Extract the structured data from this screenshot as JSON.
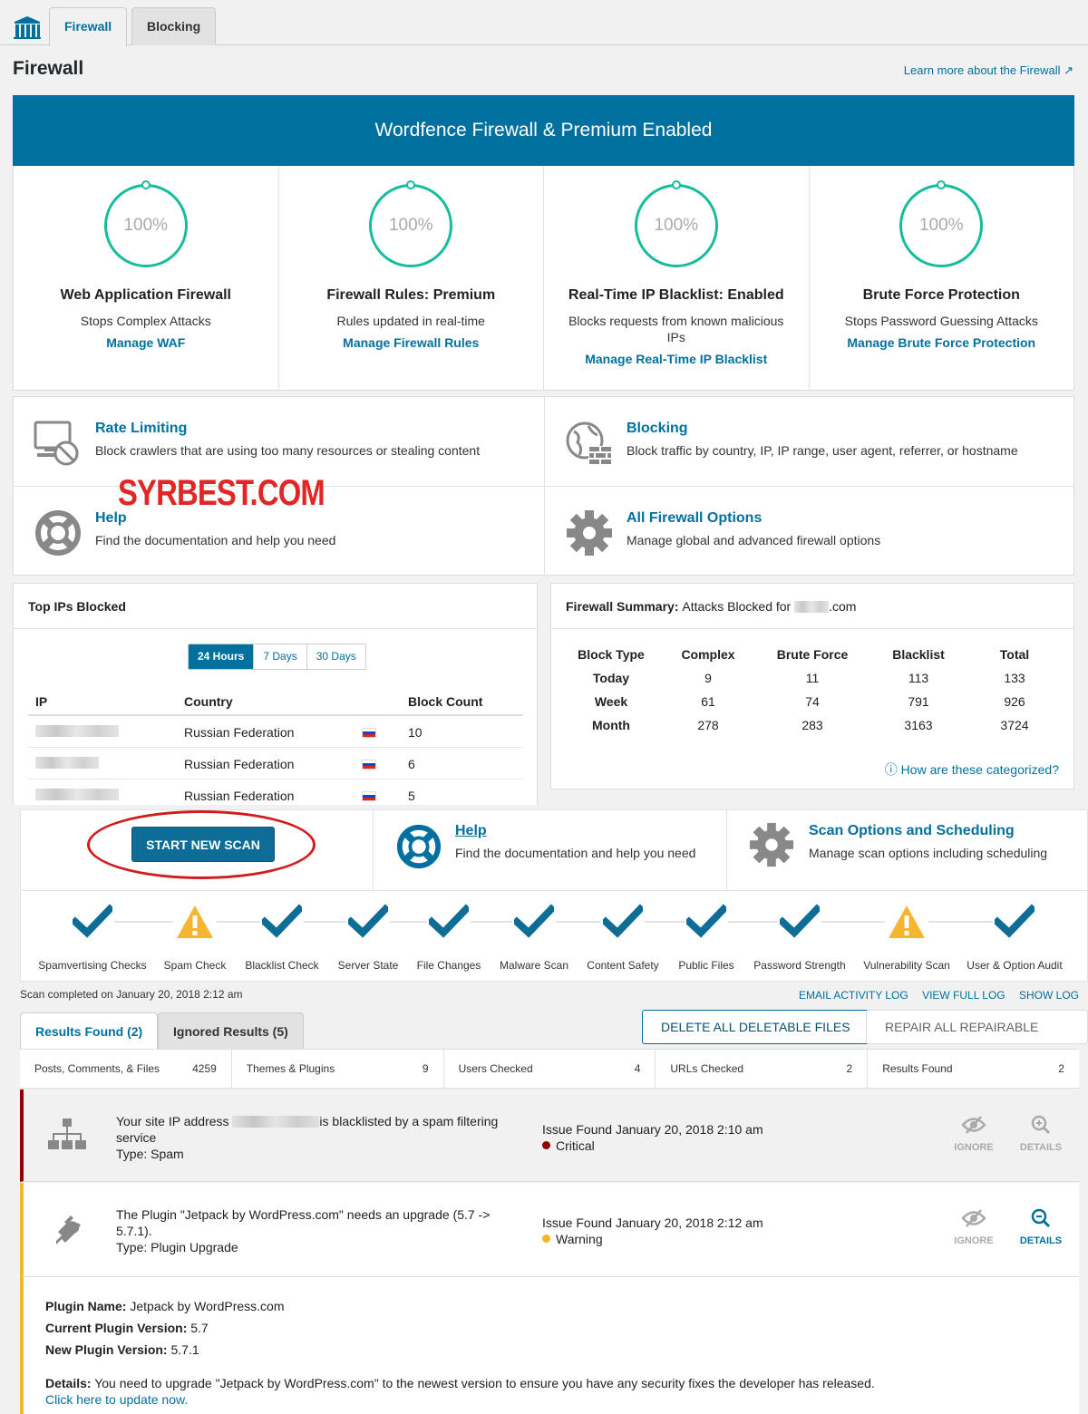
{
  "tabs": [
    {
      "label": "Firewall"
    },
    {
      "label": "Blocking"
    }
  ],
  "page": {
    "title": "Firewall",
    "learn_more": "Learn more about the Firewall"
  },
  "banner": {
    "title": "Wordfence Firewall & Premium Enabled"
  },
  "features": [
    {
      "percent": "100%",
      "value": 100,
      "title": "Web Application Firewall",
      "desc": "Stops Complex Attacks",
      "link": "Manage WAF"
    },
    {
      "percent": "100%",
      "value": 100,
      "title": "Firewall Rules: Premium",
      "desc": "Rules updated in real-time",
      "link": "Manage Firewall Rules"
    },
    {
      "percent": "100%",
      "value": 100,
      "title": "Real-Time IP Blacklist: Enabled",
      "desc": "Blocks requests from known malicious IPs",
      "link": "Manage Real-Time IP Blacklist"
    },
    {
      "percent": "100%",
      "value": 100,
      "title": "Brute Force Protection",
      "desc": "Stops Password Guessing Attacks",
      "link": "Manage Brute Force Protection"
    }
  ],
  "options": {
    "rate_limiting": {
      "title": "Rate Limiting",
      "desc": "Block crawlers that are using too many resources or stealing content"
    },
    "blocking": {
      "title": "Blocking",
      "desc": "Block traffic by country, IP, IP range, user agent, referrer, or hostname"
    },
    "help": {
      "title": "Help",
      "desc": "Find the documentation and help you need"
    },
    "all_options": {
      "title": "All Firewall Options",
      "desc": "Manage global and advanced firewall options"
    }
  },
  "watermark": "SYRBEST.COM",
  "top_ips": {
    "title": "Top IPs Blocked",
    "ranges": [
      "24 Hours",
      "7 Days",
      "30 Days"
    ],
    "selected_range": "24 Hours",
    "columns": [
      "IP",
      "Country",
      "Block Count"
    ],
    "rows": [
      {
        "country": "Russian Federation",
        "count": "10"
      },
      {
        "country": "Russian Federation",
        "count": "6"
      },
      {
        "country": "Russian Federation",
        "count": "5"
      }
    ]
  },
  "summary": {
    "title": "Firewall Summary:",
    "subtitle_prefix": "Attacks Blocked for",
    "subtitle_suffix": ".com",
    "columns": [
      "Block Type",
      "Complex",
      "Brute Force",
      "Blacklist",
      "Total"
    ],
    "rows": [
      [
        "Today",
        "9",
        "11",
        "113",
        "133"
      ],
      [
        "Week",
        "61",
        "74",
        "791",
        "926"
      ],
      [
        "Month",
        "278",
        "283",
        "3163",
        "3724"
      ]
    ],
    "categorized_link": "How are these categorized?"
  },
  "scan": {
    "start_button": "START NEW SCAN",
    "help": {
      "title": "Help",
      "desc": "Find the documentation and help you need"
    },
    "options": {
      "title": "Scan Options and Scheduling",
      "desc": "Manage scan options including scheduling"
    },
    "steps": [
      {
        "label": "Spamvertising Checks",
        "status": "ok"
      },
      {
        "label": "Spam Check",
        "status": "warning"
      },
      {
        "label": "Blacklist Check",
        "status": "ok"
      },
      {
        "label": "Server State",
        "status": "ok"
      },
      {
        "label": "File Changes",
        "status": "ok"
      },
      {
        "label": "Malware Scan",
        "status": "ok"
      },
      {
        "label": "Content Safety",
        "status": "ok"
      },
      {
        "label": "Public Files",
        "status": "ok"
      },
      {
        "label": "Password Strength",
        "status": "ok"
      },
      {
        "label": "Vulnerability Scan",
        "status": "warning"
      },
      {
        "label": "User & Option Audit",
        "status": "ok"
      }
    ],
    "completed": "Scan completed on January 20, 2018 2:12 am",
    "log_links": [
      "EMAIL ACTIVITY LOG",
      "VIEW FULL LOG",
      "SHOW LOG"
    ],
    "results_tab": "Results Found (2)",
    "ignored_tab": "Ignored Results (5)",
    "delete_button": "DELETE ALL DELETABLE FILES",
    "repair_button": "REPAIR ALL REPAIRABLE FILES",
    "stats": [
      {
        "label": "Posts, Comments, & Files",
        "value": "4259"
      },
      {
        "label": "Themes & Plugins",
        "value": "9"
      },
      {
        "label": "Users Checked",
        "value": "4"
      },
      {
        "label": "URLs Checked",
        "value": "2"
      },
      {
        "label": "Results Found",
        "value": "2"
      }
    ]
  },
  "issues": [
    {
      "text_a": "Your site IP address",
      "text_b": "is blacklisted by a spam filtering service",
      "type": "Type: Spam",
      "found": "Issue Found January 20, 2018 2:10 am",
      "severity": "Critical",
      "severity_color": "#930000",
      "ignore": "IGNORE",
      "details": "DETAILS"
    },
    {
      "text": "The Plugin \"Jetpack by WordPress.com\" needs an upgrade (5.7 -> 5.7.1).",
      "type": "Type: Plugin Upgrade",
      "found": "Issue Found January 20, 2018 2:12 am",
      "severity": "Warning",
      "severity_color": "#f0b72f",
      "ignore": "IGNORE",
      "details": "DETAILS"
    }
  ],
  "plugin_details": {
    "name_label": "Plugin Name:",
    "name": "Jetpack by WordPress.com",
    "current_label": "Current Plugin Version:",
    "current": "5.7",
    "new_label": "New Plugin Version:",
    "new": "5.7.1",
    "details_label": "Details:",
    "details": "You need to upgrade \"Jetpack by WordPress.com\" to the newest version to ensure you have any security fixes the developer has released.",
    "update_link": "Click here to update now."
  },
  "colors": {
    "accent": "#00709e",
    "success": "#16bc9b",
    "critical": "#930000",
    "warning": "#f0b72f"
  }
}
